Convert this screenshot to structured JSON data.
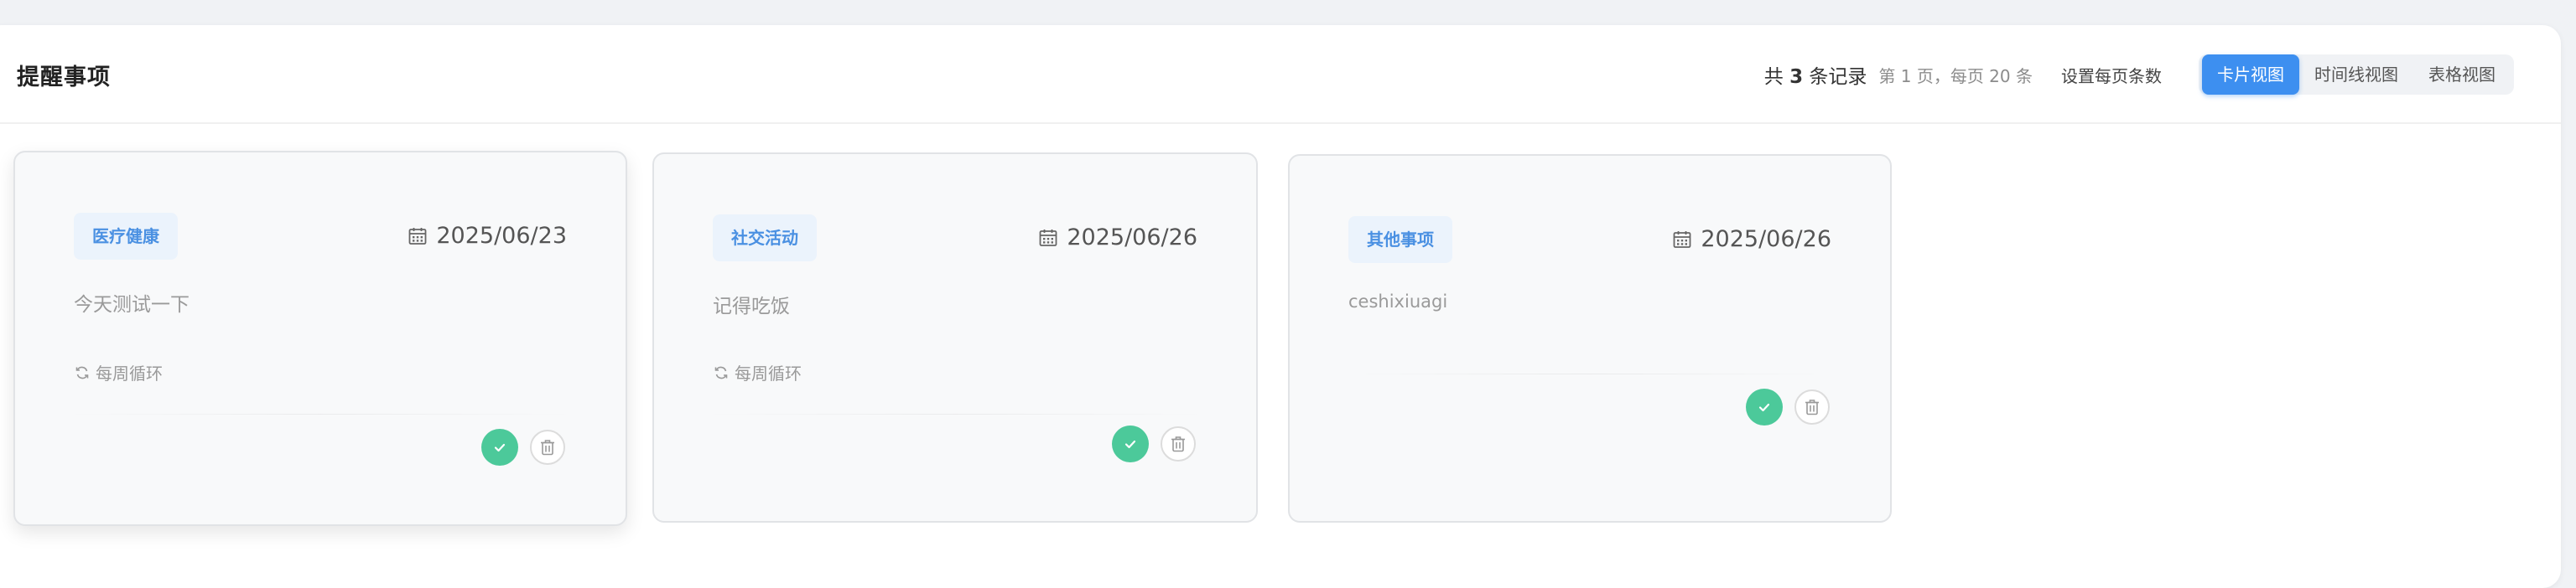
{
  "header": {
    "title": "提醒事项",
    "total_prefix": "共 ",
    "total_count": "3",
    "total_suffix": " 条记录",
    "page_info": "第 1 页，每页 20 条",
    "page_size_label": "设置每页条数",
    "views": [
      {
        "label": "卡片视图",
        "active": true
      },
      {
        "label": "时间线视图",
        "active": false
      },
      {
        "label": "表格视图",
        "active": false
      }
    ]
  },
  "cards": [
    {
      "category": "医疗健康",
      "date": "2025/06/23",
      "description": "今天测试一下",
      "repeat": "每周循环"
    },
    {
      "category": "社交活动",
      "date": "2025/06/26",
      "description": "记得吃饭",
      "repeat": "每周循环"
    },
    {
      "category": "其他事项",
      "date": "2025/06/26",
      "description": "ceshixiuagi",
      "repeat": ""
    }
  ],
  "colors": {
    "accent": "#3d8ff0",
    "tag_text": "#4a90e2",
    "tag_bg": "#ebf3fc",
    "done": "#4cc99a"
  },
  "icons": {
    "date": "calendar-icon",
    "repeat": "repeat-icon",
    "done": "check-icon",
    "delete": "trash-icon"
  }
}
